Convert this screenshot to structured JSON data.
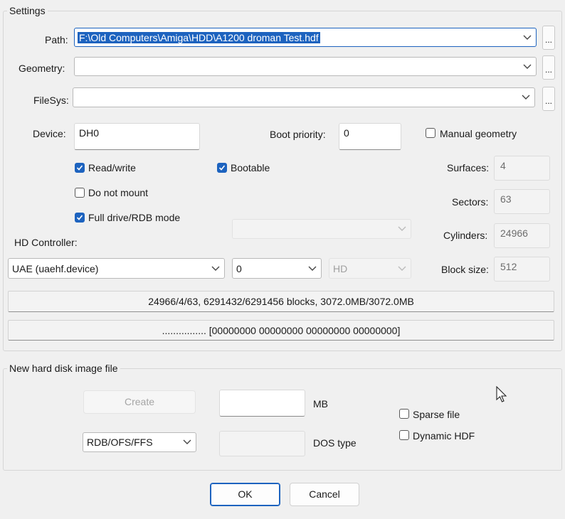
{
  "settings": {
    "legend": "Settings",
    "path": {
      "label": "Path:",
      "value": "F:\\Old Computers\\Amiga\\HDD\\A1200 droman Test.hdf",
      "browse": "..."
    },
    "geometry": {
      "label": "Geometry:",
      "value": "",
      "browse": "..."
    },
    "filesys": {
      "label": "FileSys:",
      "value": "",
      "browse": "..."
    },
    "device": {
      "label": "Device:",
      "value": "DH0"
    },
    "boot_priority": {
      "label": "Boot priority:",
      "value": "0"
    },
    "manual_geometry": {
      "label": "Manual geometry",
      "checked": false
    },
    "read_write": {
      "label": "Read/write",
      "checked": true
    },
    "bootable": {
      "label": "Bootable",
      "checked": true
    },
    "do_not_mount": {
      "label": "Do not mount",
      "checked": false
    },
    "full_drive": {
      "label": "Full drive/RDB mode",
      "checked": true
    },
    "extra_select": {
      "value": ""
    },
    "surfaces": {
      "label": "Surfaces:",
      "value": "4"
    },
    "sectors": {
      "label": "Sectors:",
      "value": "63"
    },
    "cylinders": {
      "label": "Cylinders:",
      "value": "24966"
    },
    "block_size": {
      "label": "Block size:",
      "value": "512"
    },
    "hd_controller": {
      "label": "HD Controller:",
      "value": "UAE (uaehf.device)",
      "unit": "0",
      "type": "HD"
    },
    "info_line": "24966/4/63, 6291432/6291456 blocks, 3072.0MB/3072.0MB",
    "hex_line": "................ [00000000 00000000 00000000 00000000]"
  },
  "new_image": {
    "legend": "New hard disk image file",
    "create_label": "Create",
    "size_value": "",
    "size_unit": "MB",
    "format_value": "RDB/OFS/FFS",
    "dos_type_value": "",
    "dos_type_label": "DOS type",
    "sparse_file": {
      "label": "Sparse file",
      "checked": false
    },
    "dynamic_hdf": {
      "label": "Dynamic HDF",
      "checked": false
    }
  },
  "footer": {
    "ok_label": "OK",
    "cancel_label": "Cancel"
  }
}
